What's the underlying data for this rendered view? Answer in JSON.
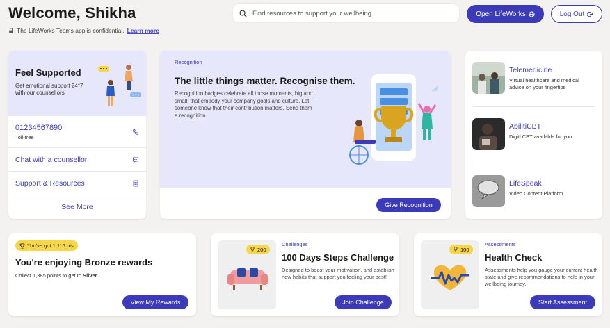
{
  "header": {
    "welcome": "Welcome, Shikha",
    "confidential_text": "The LifeWorks Teams app is confidential.",
    "learn_more": "Learn more",
    "search_placeholder": "Find resources to support your wellbeing",
    "open_lifeworks": "Open LifeWorks",
    "logout": "Log Out"
  },
  "support": {
    "title": "Feel Supported",
    "subtitle": "Get emotional support 24*7 with our counsellors",
    "phone": "01234567890",
    "toll_free": "Toll-free",
    "chat": "Chat with a counsellor",
    "resources": "Support & Resources",
    "see_more": "See More"
  },
  "recognition": {
    "tag": "Recognition",
    "title": "The little things matter. Recognise them.",
    "description": "Recognition badges celebrate all those moments, big and small, that embody your company goals and culture. Let someone know that their contribution matters. Send them a recognition",
    "button": "Give Recognition"
  },
  "services": [
    {
      "title": "Telemedicine",
      "description": "Virtual healthcare and medical advice on your fingertips"
    },
    {
      "title": "AbilitiCBT",
      "description": "Digitl CBT available for you"
    },
    {
      "title": "LifeSpeak",
      "description": "Video Content Platform"
    }
  ],
  "rewards": {
    "badge": "You've got 1,115 pts",
    "title": "You're enjoying Bronze rewards",
    "subtitle_prefix": "Collect 1,385 points to get to ",
    "subtitle_level": "Silver",
    "button": "View My Rewards"
  },
  "challenge": {
    "badge": "200",
    "tag": "Challenges",
    "title": "100 Days Steps Challenge",
    "description": "Designed to boost your motivation, and establish new habits that support you feeling your best!",
    "button": "Join Challenge"
  },
  "assessment": {
    "badge": "100",
    "tag": "Assessments",
    "title": "Health Check",
    "description": "Assessments help you gauge your current health state and give recommendations to help in your wellbeing journey.",
    "button": "Start Assessment"
  },
  "colors": {
    "primary": "#3b3ab8",
    "lavender": "#e7e7fb",
    "badge_yellow": "#f7d64a",
    "page_bg": "#f3f2f1"
  }
}
